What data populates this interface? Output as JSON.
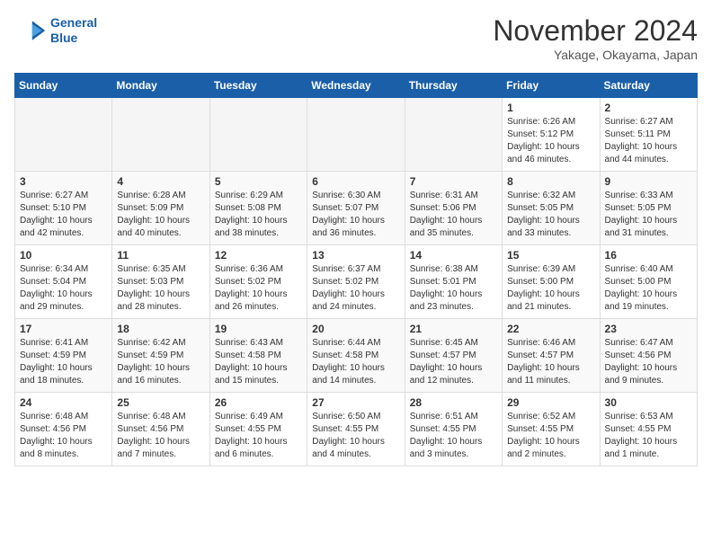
{
  "header": {
    "logo_line1": "General",
    "logo_line2": "Blue",
    "month": "November 2024",
    "location": "Yakage, Okayama, Japan"
  },
  "weekdays": [
    "Sunday",
    "Monday",
    "Tuesday",
    "Wednesday",
    "Thursday",
    "Friday",
    "Saturday"
  ],
  "weeks": [
    [
      {
        "day": "",
        "info": ""
      },
      {
        "day": "",
        "info": ""
      },
      {
        "day": "",
        "info": ""
      },
      {
        "day": "",
        "info": ""
      },
      {
        "day": "",
        "info": ""
      },
      {
        "day": "1",
        "info": "Sunrise: 6:26 AM\nSunset: 5:12 PM\nDaylight: 10 hours and 46 minutes."
      },
      {
        "day": "2",
        "info": "Sunrise: 6:27 AM\nSunset: 5:11 PM\nDaylight: 10 hours and 44 minutes."
      }
    ],
    [
      {
        "day": "3",
        "info": "Sunrise: 6:27 AM\nSunset: 5:10 PM\nDaylight: 10 hours and 42 minutes."
      },
      {
        "day": "4",
        "info": "Sunrise: 6:28 AM\nSunset: 5:09 PM\nDaylight: 10 hours and 40 minutes."
      },
      {
        "day": "5",
        "info": "Sunrise: 6:29 AM\nSunset: 5:08 PM\nDaylight: 10 hours and 38 minutes."
      },
      {
        "day": "6",
        "info": "Sunrise: 6:30 AM\nSunset: 5:07 PM\nDaylight: 10 hours and 36 minutes."
      },
      {
        "day": "7",
        "info": "Sunrise: 6:31 AM\nSunset: 5:06 PM\nDaylight: 10 hours and 35 minutes."
      },
      {
        "day": "8",
        "info": "Sunrise: 6:32 AM\nSunset: 5:05 PM\nDaylight: 10 hours and 33 minutes."
      },
      {
        "day": "9",
        "info": "Sunrise: 6:33 AM\nSunset: 5:05 PM\nDaylight: 10 hours and 31 minutes."
      }
    ],
    [
      {
        "day": "10",
        "info": "Sunrise: 6:34 AM\nSunset: 5:04 PM\nDaylight: 10 hours and 29 minutes."
      },
      {
        "day": "11",
        "info": "Sunrise: 6:35 AM\nSunset: 5:03 PM\nDaylight: 10 hours and 28 minutes."
      },
      {
        "day": "12",
        "info": "Sunrise: 6:36 AM\nSunset: 5:02 PM\nDaylight: 10 hours and 26 minutes."
      },
      {
        "day": "13",
        "info": "Sunrise: 6:37 AM\nSunset: 5:02 PM\nDaylight: 10 hours and 24 minutes."
      },
      {
        "day": "14",
        "info": "Sunrise: 6:38 AM\nSunset: 5:01 PM\nDaylight: 10 hours and 23 minutes."
      },
      {
        "day": "15",
        "info": "Sunrise: 6:39 AM\nSunset: 5:00 PM\nDaylight: 10 hours and 21 minutes."
      },
      {
        "day": "16",
        "info": "Sunrise: 6:40 AM\nSunset: 5:00 PM\nDaylight: 10 hours and 19 minutes."
      }
    ],
    [
      {
        "day": "17",
        "info": "Sunrise: 6:41 AM\nSunset: 4:59 PM\nDaylight: 10 hours and 18 minutes."
      },
      {
        "day": "18",
        "info": "Sunrise: 6:42 AM\nSunset: 4:59 PM\nDaylight: 10 hours and 16 minutes."
      },
      {
        "day": "19",
        "info": "Sunrise: 6:43 AM\nSunset: 4:58 PM\nDaylight: 10 hours and 15 minutes."
      },
      {
        "day": "20",
        "info": "Sunrise: 6:44 AM\nSunset: 4:58 PM\nDaylight: 10 hours and 14 minutes."
      },
      {
        "day": "21",
        "info": "Sunrise: 6:45 AM\nSunset: 4:57 PM\nDaylight: 10 hours and 12 minutes."
      },
      {
        "day": "22",
        "info": "Sunrise: 6:46 AM\nSunset: 4:57 PM\nDaylight: 10 hours and 11 minutes."
      },
      {
        "day": "23",
        "info": "Sunrise: 6:47 AM\nSunset: 4:56 PM\nDaylight: 10 hours and 9 minutes."
      }
    ],
    [
      {
        "day": "24",
        "info": "Sunrise: 6:48 AM\nSunset: 4:56 PM\nDaylight: 10 hours and 8 minutes."
      },
      {
        "day": "25",
        "info": "Sunrise: 6:48 AM\nSunset: 4:56 PM\nDaylight: 10 hours and 7 minutes."
      },
      {
        "day": "26",
        "info": "Sunrise: 6:49 AM\nSunset: 4:55 PM\nDaylight: 10 hours and 6 minutes."
      },
      {
        "day": "27",
        "info": "Sunrise: 6:50 AM\nSunset: 4:55 PM\nDaylight: 10 hours and 4 minutes."
      },
      {
        "day": "28",
        "info": "Sunrise: 6:51 AM\nSunset: 4:55 PM\nDaylight: 10 hours and 3 minutes."
      },
      {
        "day": "29",
        "info": "Sunrise: 6:52 AM\nSunset: 4:55 PM\nDaylight: 10 hours and 2 minutes."
      },
      {
        "day": "30",
        "info": "Sunrise: 6:53 AM\nSunset: 4:55 PM\nDaylight: 10 hours and 1 minute."
      }
    ]
  ]
}
